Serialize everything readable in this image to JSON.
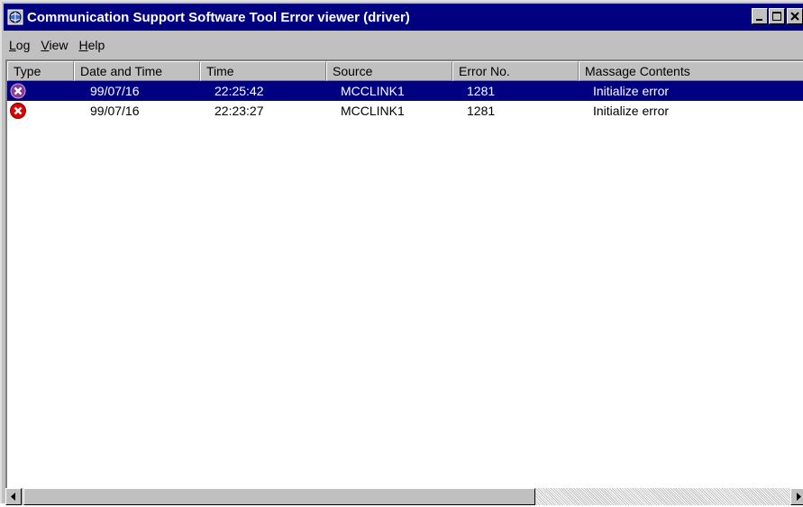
{
  "window": {
    "title": "Communication Support Software Tool Error viewer (driver)"
  },
  "menu": [
    {
      "label_rest": "og",
      "accel": "L"
    },
    {
      "label_rest": "iew",
      "accel": "V"
    },
    {
      "label_rest": "elp",
      "accel": "H"
    }
  ],
  "columns": [
    "Type",
    "Date and Time",
    "Time",
    "Source",
    "Error No.",
    "Massage Contents"
  ],
  "rows": [
    {
      "type_icon": "error-icon",
      "date": "99/07/16",
      "time": "22:25:42",
      "source": "MCCLINK1",
      "error_no": "1281",
      "message": "Initialize error",
      "selected": true
    },
    {
      "type_icon": "error-icon",
      "date": "99/07/16",
      "time": "22:23:27",
      "source": "MCCLINK1",
      "error_no": "1281",
      "message": "Initialize error",
      "selected": false
    }
  ],
  "colors": {
    "title_bar": "#000080",
    "selection": "#000080",
    "error_red": "#e00000",
    "face": "#c0c0c0"
  }
}
